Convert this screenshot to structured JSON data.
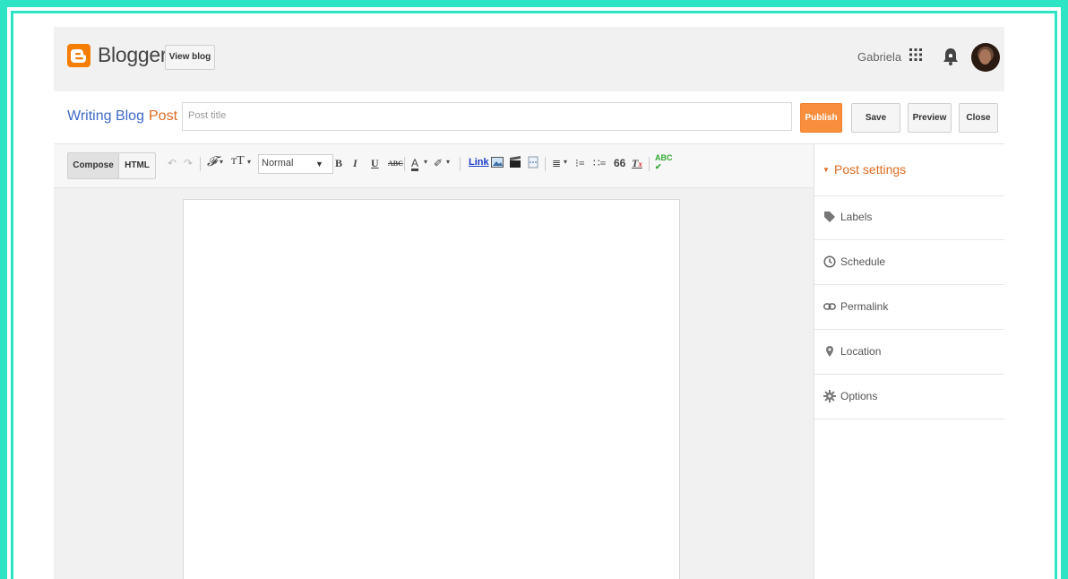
{
  "header": {
    "brand": "Blogger",
    "view_blog": "View blog",
    "user_name": "Gabriela",
    "brand_color": "#f57d00"
  },
  "titlerow": {
    "blog_name": "Writing Blog",
    "separator": "·",
    "section": "Post",
    "title_placeholder": "Post title",
    "publish": "Publish",
    "save": "Save",
    "preview": "Preview",
    "close": "Close"
  },
  "toolbar": {
    "compose": "Compose",
    "html": "HTML",
    "format_value": "Normal",
    "bold": "B",
    "italic": "I",
    "underline": "U",
    "strike": "ABC",
    "text_color": "A",
    "link": "Link",
    "quote": "66",
    "icons": [
      "undo-icon",
      "redo-icon",
      "font-family-icon",
      "font-size-icon",
      "text-color-icon",
      "highlight-icon",
      "image-icon",
      "video-icon",
      "jump-break-icon",
      "align-icon",
      "numbered-list-icon",
      "bullet-list-icon",
      "quote-icon",
      "clear-format-icon",
      "spellcheck-icon"
    ]
  },
  "sidebar": {
    "title": "Post settings",
    "items": [
      {
        "label": "Labels",
        "icon": "tag-icon"
      },
      {
        "label": "Schedule",
        "icon": "clock-icon"
      },
      {
        "label": "Permalink",
        "icon": "link-icon"
      },
      {
        "label": "Location",
        "icon": "pin-icon"
      },
      {
        "label": "Options",
        "icon": "gear-icon"
      }
    ]
  },
  "colors": {
    "frame": "#2de5c4",
    "accent": "#dd6b20",
    "publish": "#f98e3d",
    "blog_link": "#3f6ac8"
  }
}
